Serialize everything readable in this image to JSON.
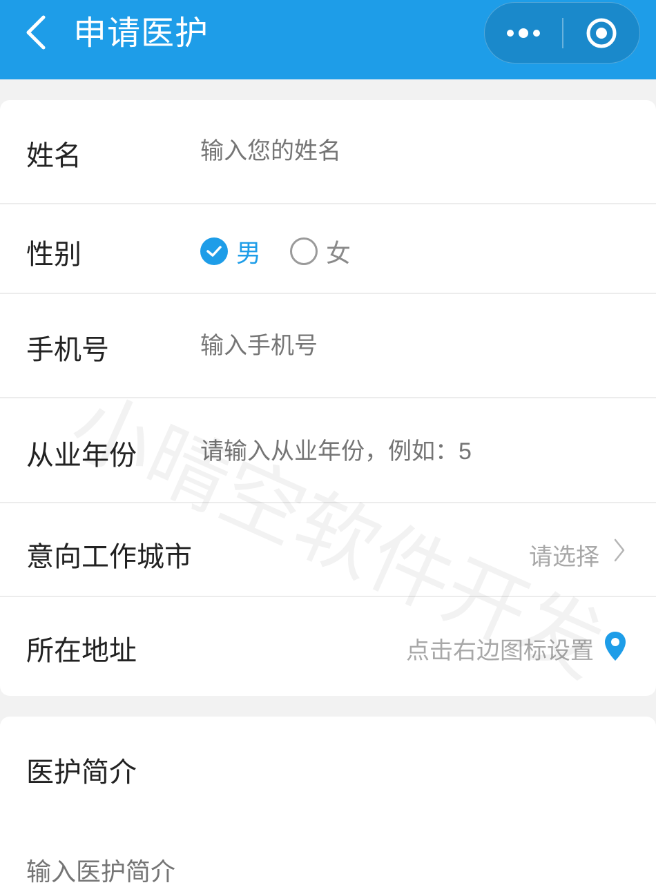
{
  "header": {
    "title": "申请医护",
    "back_icon": "chevron-left-icon",
    "more_icon": "more-dots-icon",
    "close_icon": "target-circle-icon",
    "bg_color": "#1e9de8"
  },
  "form": {
    "name": {
      "label": "姓名",
      "placeholder": "输入您的姓名"
    },
    "gender": {
      "label": "性别",
      "options": [
        {
          "label": "男",
          "selected": true
        },
        {
          "label": "女",
          "selected": false
        }
      ]
    },
    "phone": {
      "label": "手机号",
      "placeholder": "输入手机号"
    },
    "years": {
      "label": "从业年份",
      "placeholder": "请输入从业年份，例如：5"
    },
    "city": {
      "label": "意向工作城市",
      "value_placeholder": "请选择",
      "icon": "chevron-right-icon"
    },
    "address": {
      "label": "所在地址",
      "value_placeholder": "点击右边图标设置",
      "icon": "location-pin-icon"
    }
  },
  "intro": {
    "label": "医护简介",
    "placeholder": "输入医护简介"
  },
  "watermark": "小晴空软件开发",
  "colors": {
    "accent": "#1e9de8",
    "placeholder": "#8a8a8a"
  }
}
